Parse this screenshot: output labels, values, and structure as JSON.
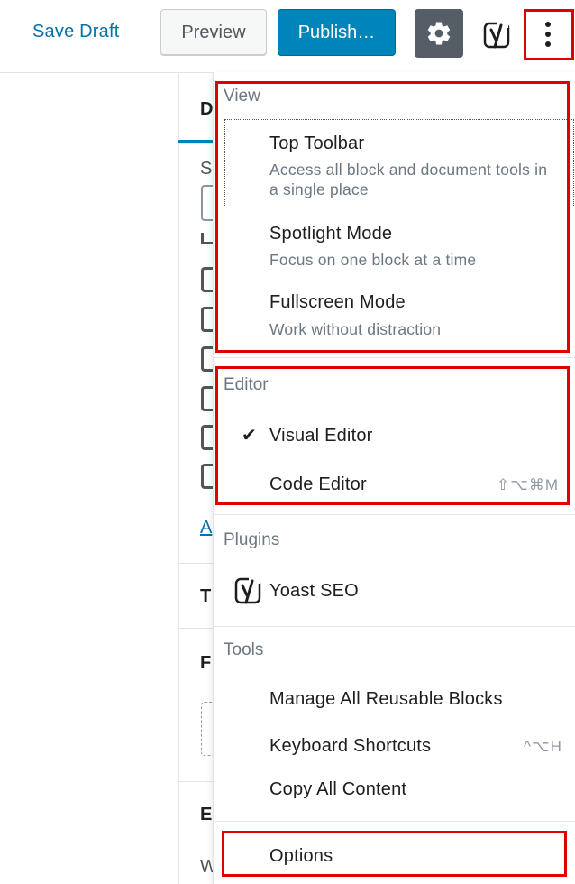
{
  "header": {
    "save_draft": "Save Draft",
    "preview": "Preview",
    "publish": "Publish…"
  },
  "sidebar": {
    "tab_initial": "D",
    "letters": [
      "S",
      "A",
      "T",
      "F",
      "E",
      "W"
    ]
  },
  "menu": {
    "view": {
      "label": "View",
      "items": [
        {
          "title": "Top Toolbar",
          "desc": "Access all block and document tools in a single place"
        },
        {
          "title": "Spotlight Mode",
          "desc": "Focus on one block at a time"
        },
        {
          "title": "Fullscreen Mode",
          "desc": "Work without distraction"
        }
      ]
    },
    "editor": {
      "label": "Editor",
      "items": [
        {
          "title": "Visual Editor",
          "checked": true
        },
        {
          "title": "Code Editor",
          "shortcut": "⇧⌥⌘M"
        }
      ]
    },
    "plugins": {
      "label": "Plugins",
      "items": [
        {
          "title": "Yoast SEO",
          "icon": "yoast-icon"
        }
      ]
    },
    "tools": {
      "label": "Tools",
      "items": [
        {
          "title": "Manage All Reusable Blocks"
        },
        {
          "title": "Keyboard Shortcuts",
          "shortcut": "^⌥H"
        },
        {
          "title": "Copy All Content"
        }
      ]
    },
    "options": {
      "title": "Options"
    }
  },
  "colors": {
    "accent": "#0085ba",
    "link": "#0073aa",
    "highlight": "#e00000",
    "settings_bg": "#555d66"
  }
}
